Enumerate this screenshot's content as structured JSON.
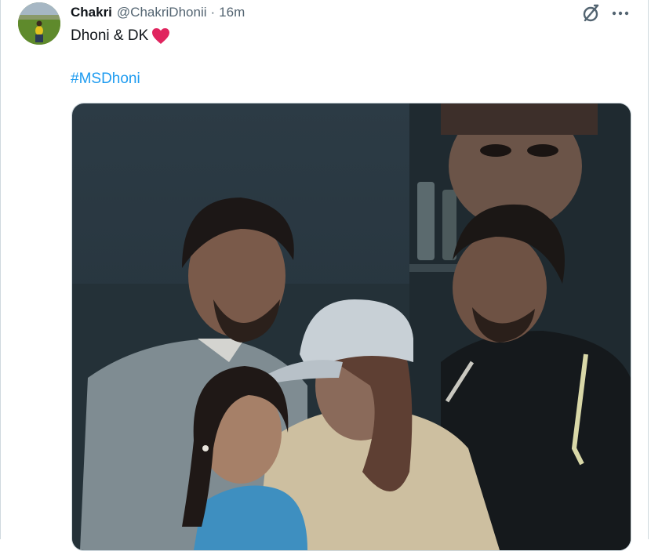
{
  "tweet": {
    "author": {
      "display_name": "Chakri",
      "handle": "@ChakriDhonii",
      "separator": "·",
      "timestamp": "16m",
      "avatar_icon": "profile-avatar"
    },
    "text": "Dhoni & DK",
    "text_emoji": "heart-icon",
    "hashtag": "#MSDhoni",
    "actions": {
      "grok_icon": "grok-icon",
      "more_icon": "more-icon"
    },
    "media": {
      "type": "photo",
      "description_icon": "photo-media"
    }
  },
  "colors": {
    "text_primary": "#0f1419",
    "text_secondary": "#536471",
    "link": "#1d9bf0",
    "heart": "#e0245e",
    "border": "#cfd9de"
  }
}
